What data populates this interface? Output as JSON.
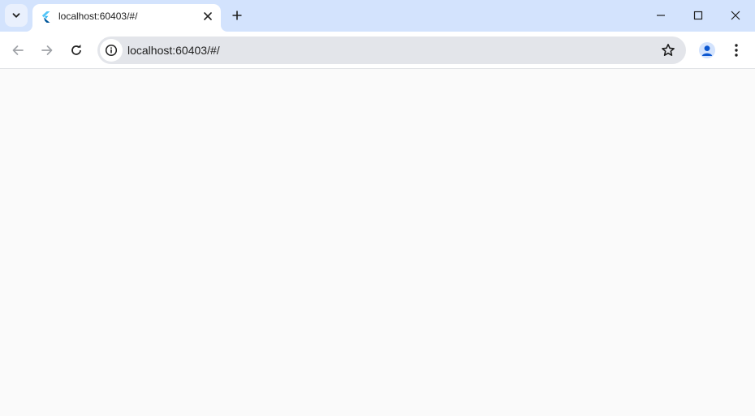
{
  "window": {
    "colors": {
      "tabstrip": "#d3e3fd",
      "toolbar": "#ffffff",
      "omnibox": "#e3e5ea",
      "content": "#fafafa",
      "favicon": "#29b6f6",
      "profile": "#0b57d0"
    }
  },
  "tabs": [
    {
      "title": "localhost:60403/#/",
      "favicon": "flutter-icon",
      "active": true
    }
  ],
  "toolbar": {
    "url": "localhost:60403/#/",
    "icons": [
      "back-arrow-icon",
      "forward-arrow-icon",
      "reload-icon",
      "info-icon",
      "star-icon",
      "profile-icon",
      "more-vert-icon"
    ]
  }
}
